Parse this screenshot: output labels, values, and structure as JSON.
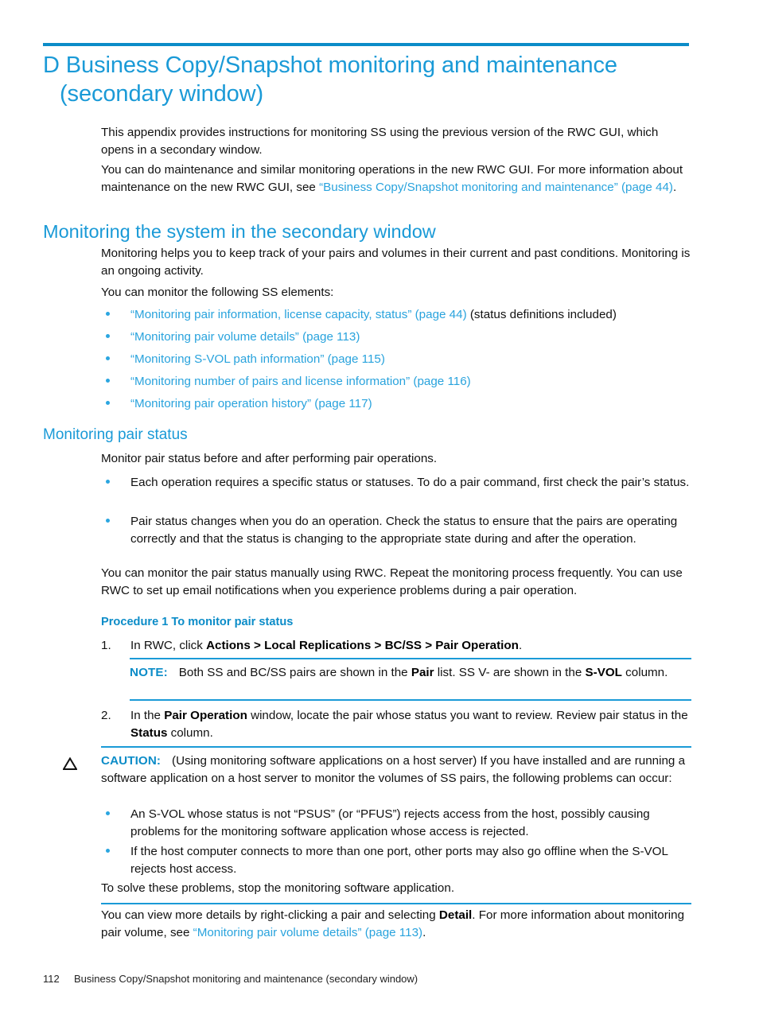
{
  "document": {
    "chapter_label": "D",
    "chapter_title_line1": "D Business Copy/Snapshot monitoring and maintenance",
    "chapter_title_line2": "(secondary window)"
  },
  "intro": {
    "para1": "This appendix provides instructions for monitoring SS using the previous version of the RWC GUI, which opens in a secondary window.",
    "para2_pre": "You can do maintenance and similar monitoring operations in the new RWC GUI. For more information about maintenance on the new RWC GUI, see ",
    "para2_link": "“Business Copy/Snapshot monitoring and maintenance” (page 44)",
    "para2_post": "."
  },
  "section_monitoring_system": {
    "heading": "Monitoring the system in the secondary window",
    "para1": "Monitoring helps you to keep track of your pairs and volumes in their current and past conditions. Monitoring is an ongoing activity.",
    "para2": "You can monitor the following SS elements:",
    "bullets": [
      {
        "link": "“Monitoring pair information, license capacity, status” (page 44)",
        "tail": " (status definitions included)"
      },
      {
        "link": "“Monitoring pair volume details” (page 113)",
        "tail": ""
      },
      {
        "link": "“Monitoring S-VOL path information” (page 115)",
        "tail": ""
      },
      {
        "link": "“Monitoring number of pairs and license information” (page 116)",
        "tail": ""
      },
      {
        "link": "“Monitoring pair operation history” (page 117)",
        "tail": ""
      }
    ]
  },
  "section_pair_status": {
    "heading": "Monitoring pair status",
    "para1": "Monitor pair status before and after performing pair operations.",
    "bullets": [
      "Each operation requires a specific status or statuses. To do a pair command, first check the pair’s status.",
      "Pair status changes when you do an operation. Check the status to ensure that the pairs are operating correctly and that the status is changing to the appropriate state during and after the operation."
    ],
    "para2": "You can monitor the pair status manually using RWC. Repeat the monitoring process frequently. You can use RWC to set up email notifications when you experience problems during a pair operation.",
    "procedure_heading": "Procedure 1 To monitor pair status",
    "step1": {
      "marker": "1.",
      "pre": "In RWC, click ",
      "bold": "Actions > Local Replications > BC/SS > Pair Operation",
      "post": "."
    },
    "note": {
      "label": "NOTE:",
      "part1": "Both SS and BC/SS pairs are shown in the ",
      "bold1": "Pair",
      "part2": " list. SS V- are shown in the ",
      "bold2": "S-VOL",
      "part3": " column."
    },
    "step2": {
      "marker": "2.",
      "pre": "In the ",
      "bold1": "Pair Operation",
      "mid": " window, locate the pair whose status you want to review. Review pair status in the ",
      "bold2": "Status",
      "post": " column."
    },
    "caution": {
      "icon": "warning-triangle-icon",
      "label": "CAUTION:",
      "body": "(Using monitoring software applications on a host server) If you have installed and are running a software application on a host server to monitor the volumes of SS pairs, the following problems can occur:",
      "bullets": [
        "An S-VOL whose status is not “PSUS” (or “PFUS”) rejects access from the host, possibly causing problems for the monitoring software application whose access is rejected.",
        "If the host computer connects to more than one port, other ports may also go offline when the S-VOL rejects host access."
      ],
      "closing": "To solve these problems, stop the monitoring software application."
    },
    "closing_pre": "You can view more details by right-clicking a pair and selecting ",
    "closing_bold": "Detail",
    "closing_mid": ". For more information about monitoring pair volume, see ",
    "closing_link": "“Monitoring pair volume details” (page 113)",
    "closing_post": "."
  },
  "footer": {
    "page_number": "112",
    "title": "Business Copy/Snapshot monitoring and maintenance (secondary window)"
  },
  "colors": {
    "accent_blue": "#1a9ad7",
    "rule_blue": "#0b8cc8",
    "link_blue": "#29a3dd",
    "body_text": "#111111"
  }
}
